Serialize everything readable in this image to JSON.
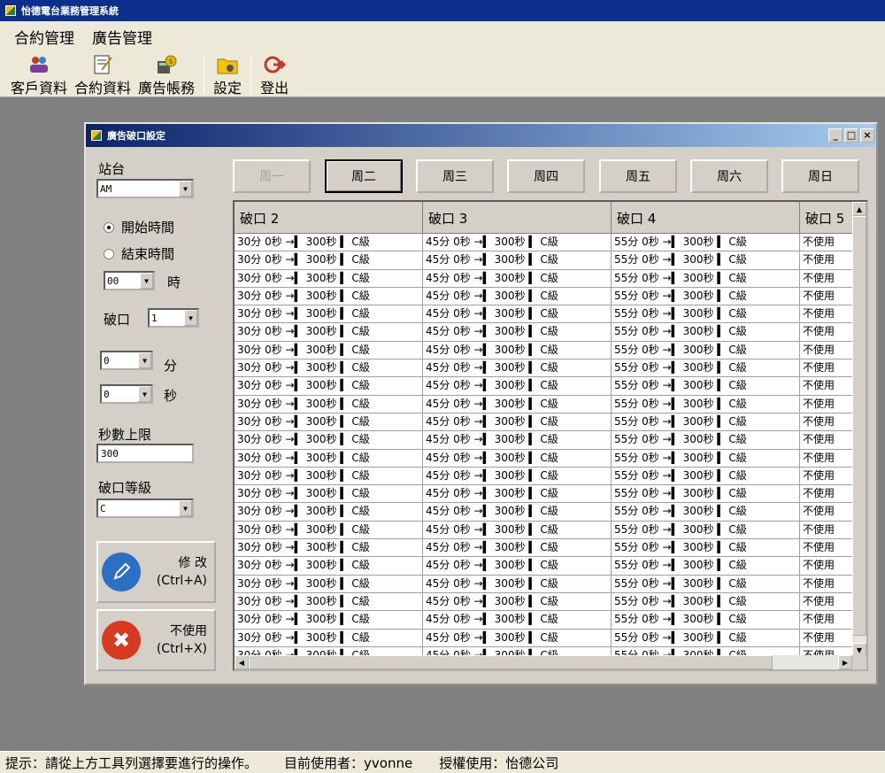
{
  "app": {
    "title": "怡德電台業務管理系統"
  },
  "menu": [
    "合約管理",
    "廣告管理"
  ],
  "toolbar": [
    {
      "label": "客戶資料",
      "icon": "customers-icon"
    },
    {
      "label": "合約資料",
      "icon": "contract-icon"
    },
    {
      "label": "廣告帳務",
      "icon": "accounting-icon"
    },
    {
      "label": "設定",
      "icon": "settings-folder-icon"
    },
    {
      "label": "登出",
      "icon": "logout-icon"
    }
  ],
  "window": {
    "title": "廣告破口設定",
    "controls": {
      "minimize": "_",
      "maximize": "□",
      "close": "×"
    }
  },
  "form": {
    "station_label": "站台",
    "station_value": "AM",
    "start_time_label": "開始時間",
    "end_time_label": "結束時間",
    "hour_value": "00",
    "hour_label": "時",
    "break_label": "破口",
    "break_value": "1",
    "minute_value": "0",
    "minute_label": "分",
    "second_value": "0",
    "second_label": "秒",
    "seconds_limit_label": "秒數上限",
    "seconds_limit_value": "300",
    "level_label": "破口等級",
    "level_value": "C",
    "modify_button": {
      "line1": "修 改",
      "line2": "(Ctrl+A)"
    },
    "disable_button": {
      "line1": "不使用",
      "line2": "(Ctrl+X)"
    }
  },
  "days": [
    {
      "label": "周一",
      "state": "disabled"
    },
    {
      "label": "周二",
      "state": "active"
    },
    {
      "label": "周三",
      "state": "normal"
    },
    {
      "label": "周四",
      "state": "normal"
    },
    {
      "label": "周五",
      "state": "normal"
    },
    {
      "label": "周六",
      "state": "normal"
    },
    {
      "label": "周日",
      "state": "normal"
    }
  ],
  "grid": {
    "headers": [
      "破口 2",
      "破口 3",
      "破口 4",
      "破口 5"
    ],
    "row_template": [
      "30分 0秒 →▍ 300秒 ▍ C級",
      "45分 0秒 →▍ 300秒 ▍ C級",
      "55分 0秒 →▍ 300秒 ▍ C級",
      "不使用"
    ],
    "row_count": 24
  },
  "status": {
    "hint": "提示：請從上方工具列選擇要進行的操作。",
    "user": "目前使用者：yvonne",
    "license": "授權使用：怡德公司"
  }
}
